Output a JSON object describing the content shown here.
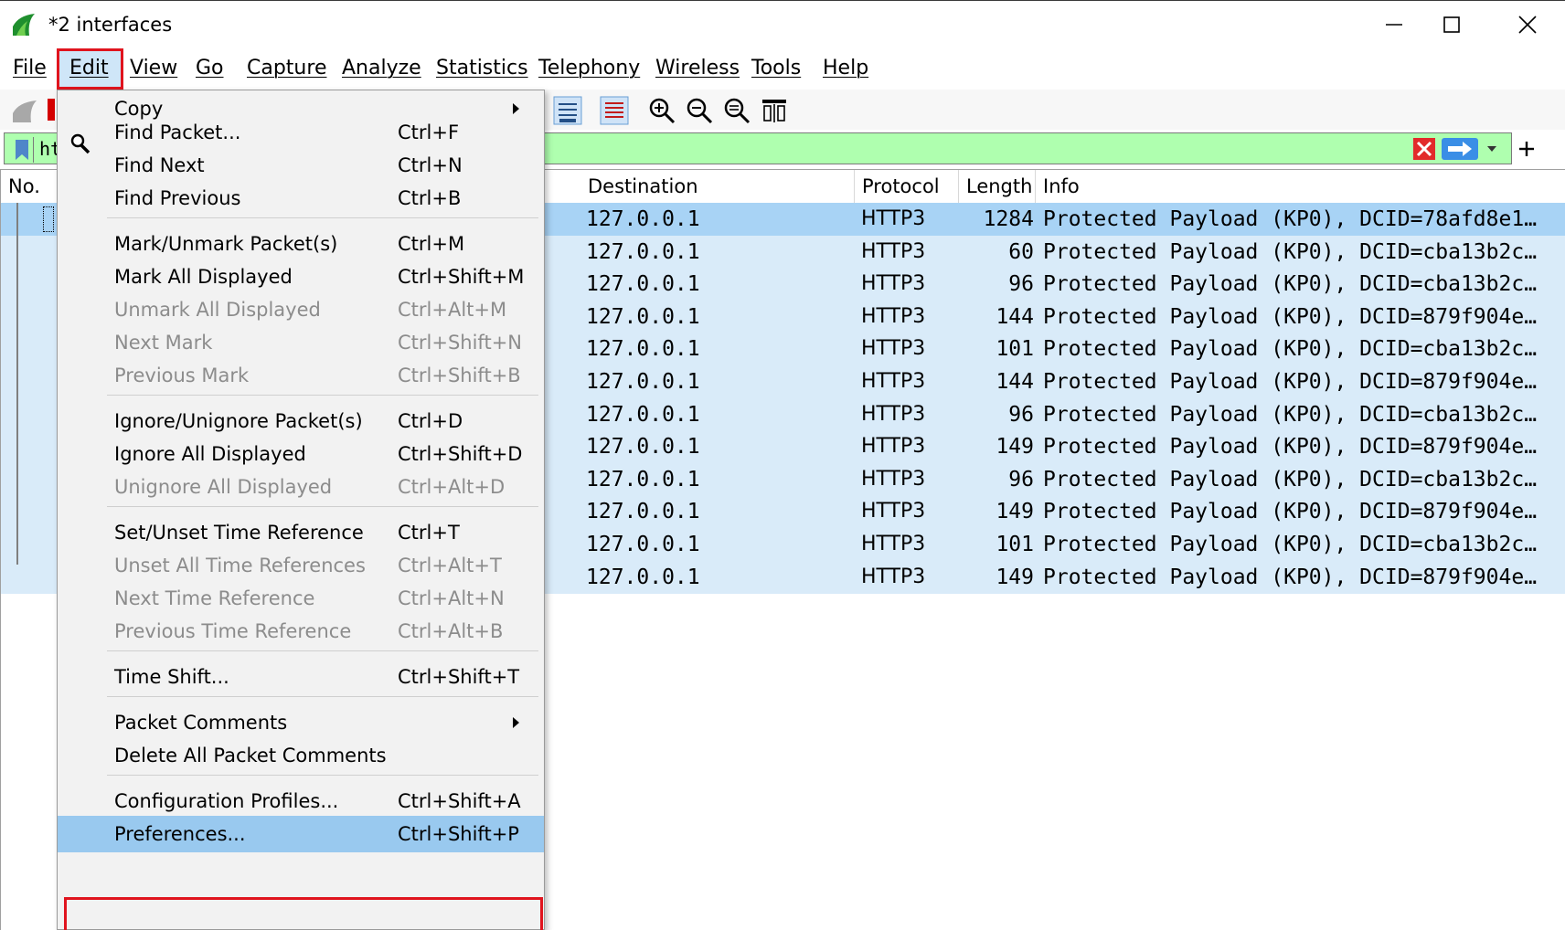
{
  "window": {
    "title": "*2 interfaces",
    "minimize_icon": "minimize-icon",
    "maximize_icon": "maximize-icon",
    "close_icon": "close-icon"
  },
  "menubar": {
    "items": [
      "File",
      "Edit",
      "View",
      "Go",
      "Capture",
      "Analyze",
      "Statistics",
      "Telephony",
      "Wireless",
      "Tools",
      "Help"
    ],
    "active": "Edit"
  },
  "filter": {
    "text": "ht",
    "background": "#afffaf"
  },
  "packet_list": {
    "columns": [
      "No.",
      "Destination",
      "Protocol",
      "Length",
      "Info"
    ],
    "rows": [
      {
        "destination": "127.0.0.1",
        "protocol": "HTTP3",
        "length": "1284",
        "info": "Protected Payload (KP0), DCID=78afd8e1…"
      },
      {
        "destination": "127.0.0.1",
        "protocol": "HTTP3",
        "length": "60",
        "info": "Protected Payload (KP0), DCID=cba13b2c…"
      },
      {
        "destination": "127.0.0.1",
        "protocol": "HTTP3",
        "length": "96",
        "info": "Protected Payload (KP0), DCID=cba13b2c…"
      },
      {
        "destination": "127.0.0.1",
        "protocol": "HTTP3",
        "length": "144",
        "info": "Protected Payload (KP0), DCID=879f904e…"
      },
      {
        "destination": "127.0.0.1",
        "protocol": "HTTP3",
        "length": "101",
        "info": "Protected Payload (KP0), DCID=cba13b2c…"
      },
      {
        "destination": "127.0.0.1",
        "protocol": "HTTP3",
        "length": "144",
        "info": "Protected Payload (KP0), DCID=879f904e…"
      },
      {
        "destination": "127.0.0.1",
        "protocol": "HTTP3",
        "length": "96",
        "info": "Protected Payload (KP0), DCID=cba13b2c…"
      },
      {
        "destination": "127.0.0.1",
        "protocol": "HTTP3",
        "length": "149",
        "info": "Protected Payload (KP0), DCID=879f904e…"
      },
      {
        "destination": "127.0.0.1",
        "protocol": "HTTP3",
        "length": "96",
        "info": "Protected Payload (KP0), DCID=cba13b2c…"
      },
      {
        "destination": "127.0.0.1",
        "protocol": "HTTP3",
        "length": "149",
        "info": "Protected Payload (KP0), DCID=879f904e…"
      },
      {
        "destination": "127.0.0.1",
        "protocol": "HTTP3",
        "length": "101",
        "info": "Protected Payload (KP0), DCID=cba13b2c…"
      },
      {
        "destination": "127.0.0.1",
        "protocol": "HTTP3",
        "length": "149",
        "info": "Protected Payload (KP0), DCID=879f904e…"
      }
    ]
  },
  "edit_menu": {
    "items": [
      {
        "label": "Copy",
        "shortcut": "",
        "submenu": true,
        "enabled": true
      },
      {
        "label": "Find Packet...",
        "shortcut": "Ctrl+F",
        "enabled": true,
        "icon": "search-icon"
      },
      {
        "label": "Find Next",
        "shortcut": "Ctrl+N",
        "enabled": true
      },
      {
        "label": "Find Previous",
        "shortcut": "Ctrl+B",
        "enabled": true
      },
      {
        "label": "Mark/Unmark Packet(s)",
        "shortcut": "Ctrl+M",
        "enabled": true
      },
      {
        "label": "Mark All Displayed",
        "shortcut": "Ctrl+Shift+M",
        "enabled": true
      },
      {
        "label": "Unmark All Displayed",
        "shortcut": "Ctrl+Alt+M",
        "enabled": false
      },
      {
        "label": "Next Mark",
        "shortcut": "Ctrl+Shift+N",
        "enabled": false
      },
      {
        "label": "Previous Mark",
        "shortcut": "Ctrl+Shift+B",
        "enabled": false
      },
      {
        "label": "Ignore/Unignore Packet(s)",
        "shortcut": "Ctrl+D",
        "enabled": true
      },
      {
        "label": "Ignore All Displayed",
        "shortcut": "Ctrl+Shift+D",
        "enabled": true
      },
      {
        "label": "Unignore All Displayed",
        "shortcut": "Ctrl+Alt+D",
        "enabled": false
      },
      {
        "label": "Set/Unset Time Reference",
        "shortcut": "Ctrl+T",
        "enabled": true
      },
      {
        "label": "Unset All Time References",
        "shortcut": "Ctrl+Alt+T",
        "enabled": false
      },
      {
        "label": "Next Time Reference",
        "shortcut": "Ctrl+Alt+N",
        "enabled": false
      },
      {
        "label": "Previous Time Reference",
        "shortcut": "Ctrl+Alt+B",
        "enabled": false
      },
      {
        "label": "Time Shift...",
        "shortcut": "Ctrl+Shift+T",
        "enabled": true
      },
      {
        "label": "Packet Comments",
        "shortcut": "",
        "submenu": true,
        "enabled": true
      },
      {
        "label": "Delete All Packet Comments",
        "shortcut": "",
        "enabled": true
      },
      {
        "label": "Configuration Profiles...",
        "shortcut": "Ctrl+Shift+A",
        "enabled": true
      },
      {
        "label": "Preferences...",
        "shortcut": "Ctrl+Shift+P",
        "enabled": true,
        "highlighted": true
      }
    ]
  },
  "colors": {
    "highlight_box": "#e0141e",
    "row_bg": "#d9ebf9",
    "row_selected": "#a8d3f5",
    "menu_hover": "#99c9ef"
  }
}
